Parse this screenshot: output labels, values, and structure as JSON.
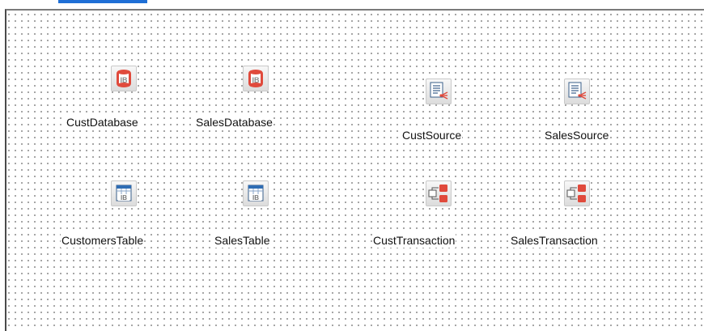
{
  "form": {
    "components": [
      {
        "label": "CustDatabase",
        "icon": "ib-database-icon"
      },
      {
        "label": "SalesDatabase",
        "icon": "ib-database-icon"
      },
      {
        "label": "CustSource",
        "icon": "data-source-icon"
      },
      {
        "label": "SalesSource",
        "icon": "data-source-icon"
      },
      {
        "label": "CustomersTable",
        "icon": "ib-table-icon"
      },
      {
        "label": "SalesTable",
        "icon": "ib-table-icon"
      },
      {
        "label": "CustTransaction",
        "icon": "ib-transaction-icon"
      },
      {
        "label": "SalesTransaction",
        "icon": "ib-transaction-icon"
      }
    ]
  },
  "colors": {
    "accent": "#1f6fd6",
    "icon_red": "#e04a3c"
  }
}
